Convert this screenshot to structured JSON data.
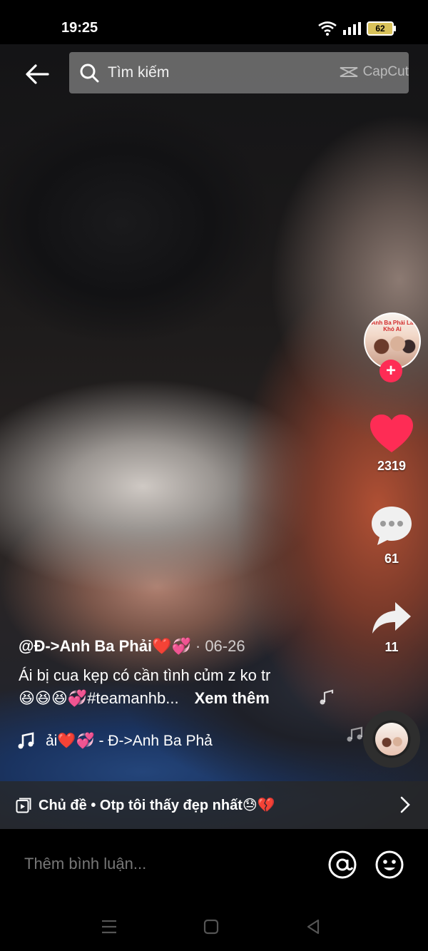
{
  "status_bar": {
    "time": "19:25",
    "battery": "62"
  },
  "search": {
    "placeholder": "Tìm kiếm",
    "brand": "CapCut"
  },
  "rail": {
    "likes": "2319",
    "comments": "61",
    "shares": "11"
  },
  "avatar_text": "Anh Ba Phải Là Khó Ai",
  "post": {
    "author": "@Đ->Anh Ba Phải❤️💞",
    "date": "· 06-26",
    "caption_line1": "Ái bị cua kẹp có cần tình củm z ko tr",
    "caption_line2": "😆😆😆💞#teamanhb...",
    "see_more": "Xem thêm"
  },
  "music": {
    "text": "ải❤️💞 - Đ->Anh Ba Phả"
  },
  "topic": {
    "label": "Chủ đề • Otp tôi thấy đẹp nhất😓💔"
  },
  "comment": {
    "placeholder": "Thêm bình luận..."
  },
  "colors": {
    "like": "#fe2c55",
    "follow": "#fe2c55",
    "battery_fill": "#d9c25a"
  },
  "icons": {
    "back": "arrow-left-icon",
    "search": "search-icon",
    "like": "heart-icon",
    "comment": "chat-bubble-icon",
    "share": "share-arrow-icon",
    "music": "music-note-icon",
    "topic": "playlist-icon",
    "mention": "at-icon",
    "emoji": "smiley-icon"
  }
}
